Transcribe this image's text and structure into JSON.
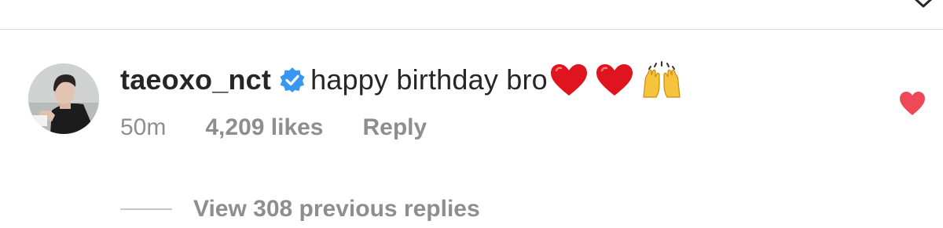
{
  "comment": {
    "username": "taeoxo_nct",
    "verified": true,
    "text": "happy birthday bro",
    "emojis": [
      "red-heart",
      "red-heart",
      "raising-hands"
    ],
    "liked": true
  },
  "meta": {
    "time": "50m",
    "likes": "4,209 likes",
    "reply": "Reply"
  },
  "replies": {
    "label": "View 308 previous replies"
  },
  "colors": {
    "text": "#262626",
    "secondary": "#8e8e8e",
    "verified": "#3897f0",
    "heart": "#ed4956",
    "divider": "#dbdbdb"
  },
  "icons": [
    "chevron-down-icon",
    "verified-badge-icon",
    "red-heart-emoji",
    "raising-hands-emoji",
    "like-heart-icon"
  ]
}
